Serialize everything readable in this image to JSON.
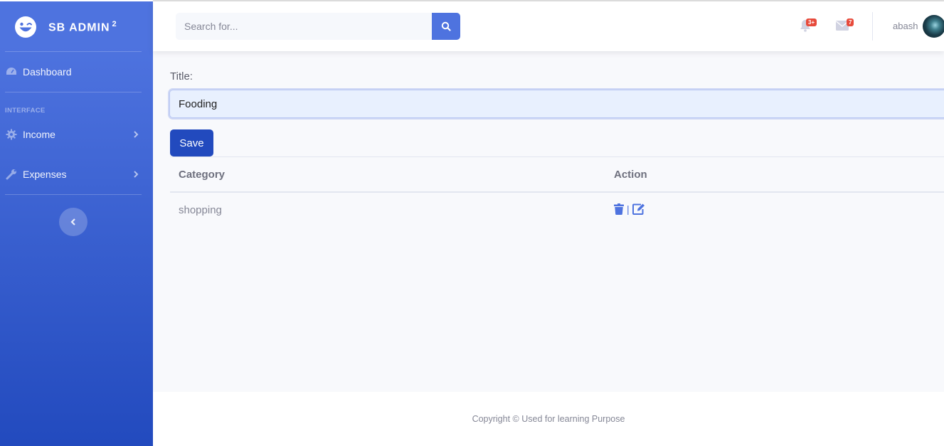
{
  "brand": {
    "name": "SB ADMIN",
    "superscript": "2"
  },
  "sidebar": {
    "dashboard_label": "Dashboard",
    "section_heading": "INTERFACE",
    "items": [
      {
        "label": "Income",
        "icon": "cog-icon"
      },
      {
        "label": "Expenses",
        "icon": "wrench-icon"
      }
    ]
  },
  "topbar": {
    "search_placeholder": "Search for...",
    "alerts_badge": "3+",
    "messages_badge": "7",
    "user_name": "abash"
  },
  "form": {
    "title_label": "Title:",
    "title_value": "Fooding",
    "save_label": "Save"
  },
  "table": {
    "headers": [
      "Category",
      "Action"
    ],
    "rows": [
      {
        "category": "shopping",
        "separator": "|"
      }
    ]
  },
  "footer": {
    "text": "Copyright © Used for learning Purpose"
  },
  "colors": {
    "primary": "#4e73df",
    "primary_dark": "#224abe",
    "danger": "#e74a3b"
  }
}
